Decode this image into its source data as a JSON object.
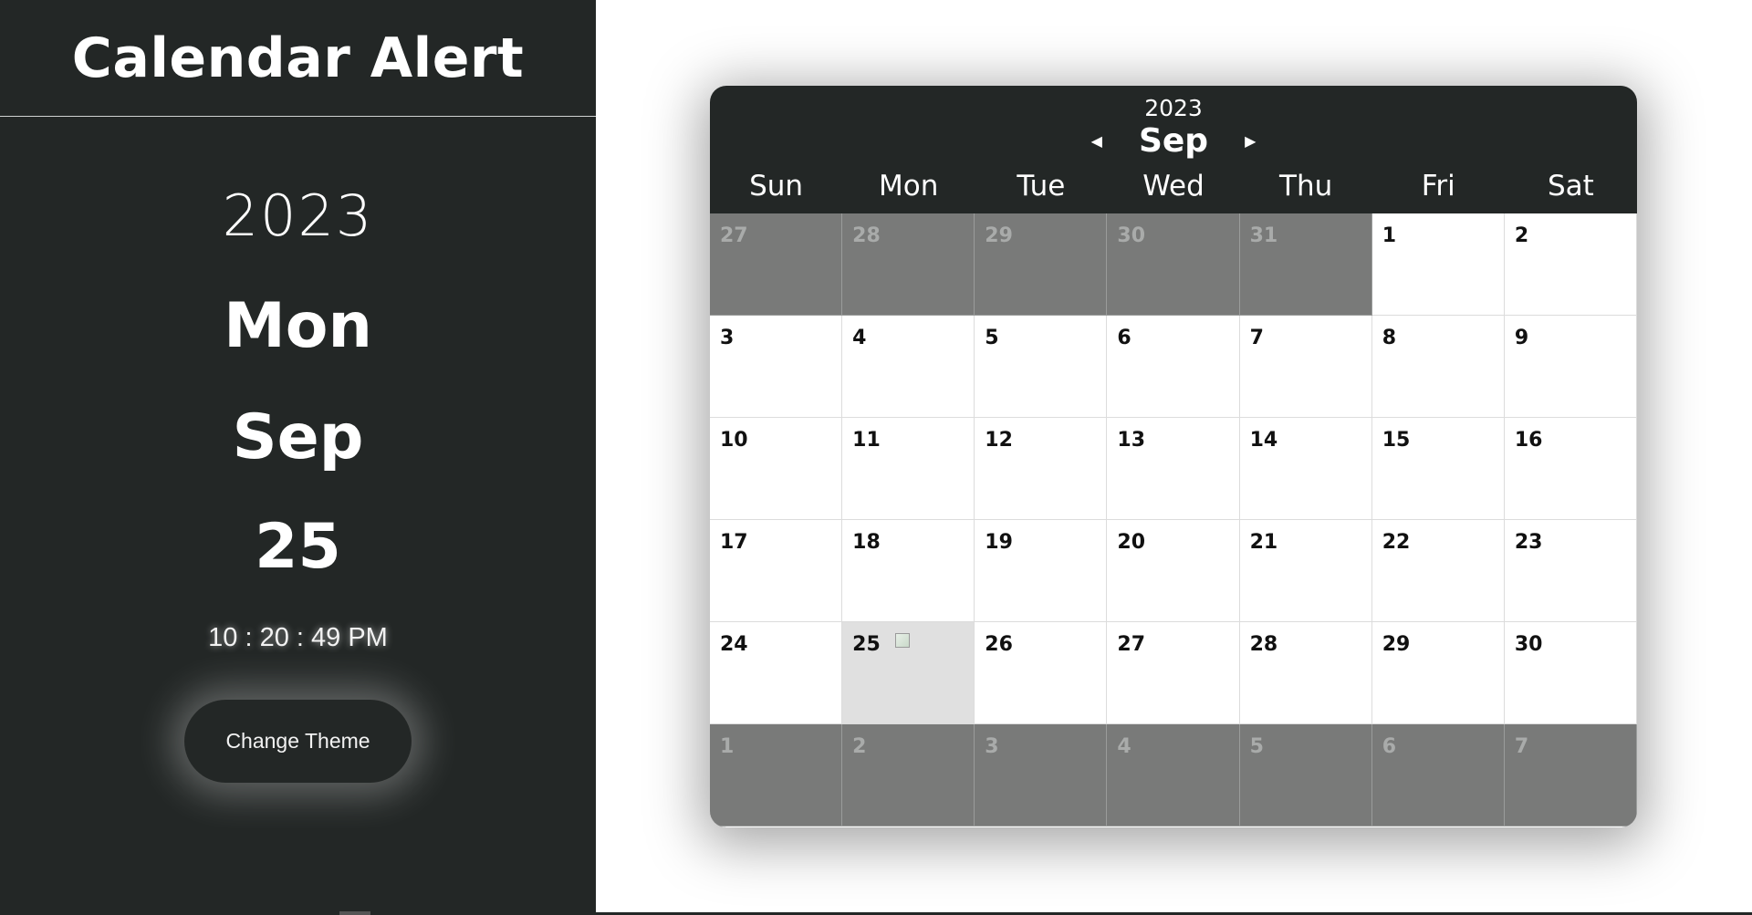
{
  "sidebar": {
    "title": "Calendar Alert",
    "year": "2023",
    "weekday": "Mon",
    "month": "Sep",
    "date": "25",
    "time": "10 : 20 : 49 PM",
    "theme_button": "Change Theme"
  },
  "calendar": {
    "year": "2023",
    "month": "Sep",
    "prev_icon": "caret-left-icon",
    "next_icon": "caret-right-icon",
    "weekdays": [
      "Sun",
      "Mon",
      "Tue",
      "Wed",
      "Thu",
      "Fri",
      "Sat"
    ],
    "days": [
      {
        "label": "27",
        "other": true
      },
      {
        "label": "28",
        "other": true
      },
      {
        "label": "29",
        "other": true
      },
      {
        "label": "30",
        "other": true
      },
      {
        "label": "31",
        "other": true
      },
      {
        "label": "1"
      },
      {
        "label": "2"
      },
      {
        "label": "3"
      },
      {
        "label": "4"
      },
      {
        "label": "5"
      },
      {
        "label": "6"
      },
      {
        "label": "7"
      },
      {
        "label": "8"
      },
      {
        "label": "9"
      },
      {
        "label": "10"
      },
      {
        "label": "11"
      },
      {
        "label": "12"
      },
      {
        "label": "13"
      },
      {
        "label": "14"
      },
      {
        "label": "15"
      },
      {
        "label": "16"
      },
      {
        "label": "17"
      },
      {
        "label": "18"
      },
      {
        "label": "19"
      },
      {
        "label": "20"
      },
      {
        "label": "21"
      },
      {
        "label": "22"
      },
      {
        "label": "23"
      },
      {
        "label": "24"
      },
      {
        "label": "25",
        "today": true,
        "image": "broken-image-icon"
      },
      {
        "label": "26"
      },
      {
        "label": "27"
      },
      {
        "label": "28"
      },
      {
        "label": "29"
      },
      {
        "label": "30"
      },
      {
        "label": "1",
        "other": true
      },
      {
        "label": "2",
        "other": true
      },
      {
        "label": "3",
        "other": true
      },
      {
        "label": "4",
        "other": true
      },
      {
        "label": "5",
        "other": true
      },
      {
        "label": "6",
        "other": true
      },
      {
        "label": "7",
        "other": true
      }
    ]
  },
  "colors": {
    "panel": "#232726",
    "other_month": "#797a79",
    "today": "#e0e0e0"
  }
}
